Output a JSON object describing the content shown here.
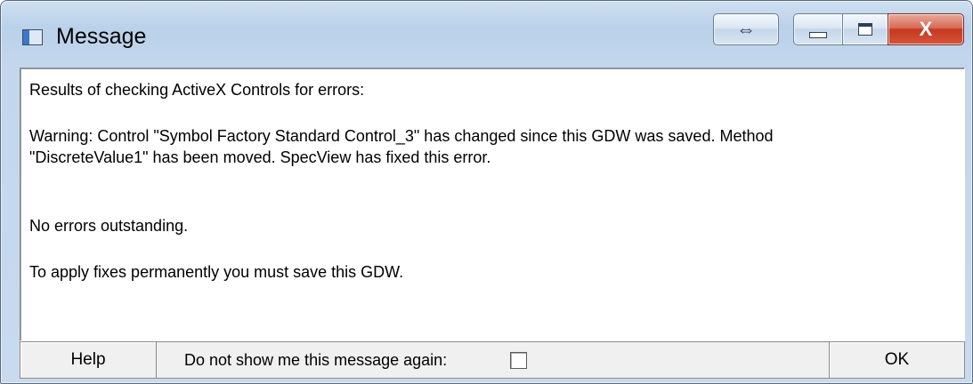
{
  "window": {
    "title": "Message",
    "title_buttons": {
      "resize_glyph": "⇔",
      "close_glyph": "X"
    }
  },
  "message": {
    "lines": [
      "Results of checking ActiveX Controls for errors:",
      "Warning: Control \"Symbol Factory Standard Control_3\" has changed since this GDW was saved. Method",
      "\"DiscreteValue1\" has been moved. SpecView has fixed this error.",
      "No errors outstanding.",
      "To apply fixes permanently you must save this GDW."
    ]
  },
  "footer": {
    "help_label": "Help",
    "dont_show_label": "Do not show me this message again:",
    "dont_show_checked": false,
    "ok_label": "OK"
  },
  "icons": {
    "app": "window-app-icon",
    "resize": "resize-arrows-icon",
    "minimize": "minimize-icon",
    "maximize": "maximize-icon",
    "close": "close-icon"
  },
  "colors": {
    "title_bar": "#b9d1ea",
    "close_button": "#c4391f",
    "content_background": "#ffffff",
    "footer_background": "#f0f0f0"
  }
}
